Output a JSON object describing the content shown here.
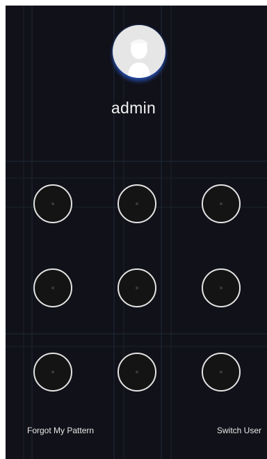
{
  "user": {
    "name": "admin",
    "avatar_icon": "user-avatar-icon"
  },
  "pattern": {
    "rows": 3,
    "cols": 3,
    "selected": []
  },
  "footer": {
    "forgot_label": "Forgot My Pattern",
    "switch_label": "Switch User"
  },
  "colors": {
    "background": "#111119",
    "ring": "#e4e4e4",
    "avatar_glow": "#2f6bd6"
  }
}
